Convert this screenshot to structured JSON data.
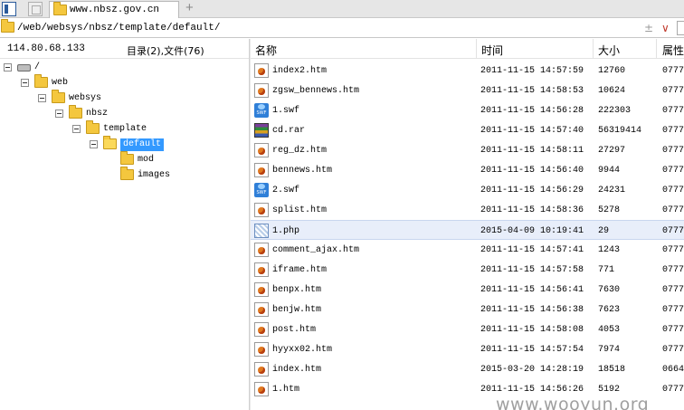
{
  "tab": {
    "title": "www.nbsz.gov.cn",
    "new_tab": "+"
  },
  "address": {
    "path": "/web/websys/nbsz/template/default/",
    "split_glyph": "±",
    "dropdown_glyph": "∨"
  },
  "left": {
    "ip": "114.80.68.133",
    "counts": "目录(2),文件(76)",
    "tree": [
      {
        "label": "/",
        "kind": "drive",
        "depth": 0,
        "expanded": true
      },
      {
        "label": "web",
        "kind": "folder",
        "depth": 1,
        "expanded": true
      },
      {
        "label": "websys",
        "kind": "folder",
        "depth": 2,
        "expanded": true
      },
      {
        "label": "nbsz",
        "kind": "folder",
        "depth": 3,
        "expanded": true
      },
      {
        "label": "template",
        "kind": "folder",
        "depth": 4,
        "expanded": true
      },
      {
        "label": "default",
        "kind": "folder",
        "depth": 5,
        "expanded": true,
        "selected": true
      },
      {
        "label": "mod",
        "kind": "folder",
        "depth": 6
      },
      {
        "label": "images",
        "kind": "folder",
        "depth": 6
      }
    ]
  },
  "columns": {
    "name": "名称",
    "time": "时间",
    "size": "大小",
    "attr": "属性"
  },
  "files": [
    {
      "name": "index2.htm",
      "type": "htm",
      "time": "2011-11-15 14:57:59",
      "size": "12760",
      "attr": "0777"
    },
    {
      "name": "zgsw_bennews.htm",
      "type": "htm",
      "time": "2011-11-15 14:58:53",
      "size": "10624",
      "attr": "0777"
    },
    {
      "name": "1.swf",
      "type": "swf",
      "time": "2011-11-15 14:56:28",
      "size": "222303",
      "attr": "0777"
    },
    {
      "name": "cd.rar",
      "type": "rar",
      "time": "2011-11-15 14:57:40",
      "size": "56319414",
      "attr": "0777"
    },
    {
      "name": "reg_dz.htm",
      "type": "htm",
      "time": "2011-11-15 14:58:11",
      "size": "27297",
      "attr": "0777"
    },
    {
      "name": "bennews.htm",
      "type": "htm",
      "time": "2011-11-15 14:56:40",
      "size": "9944",
      "attr": "0777"
    },
    {
      "name": "2.swf",
      "type": "swf",
      "time": "2011-11-15 14:56:29",
      "size": "24231",
      "attr": "0777"
    },
    {
      "name": "splist.htm",
      "type": "htm",
      "time": "2011-11-15 14:58:36",
      "size": "5278",
      "attr": "0777"
    },
    {
      "name": "1.php",
      "type": "php",
      "time": "2015-04-09 10:19:41",
      "size": "29",
      "attr": "0777",
      "selected": true
    },
    {
      "name": "comment_ajax.htm",
      "type": "htm",
      "time": "2011-11-15 14:57:41",
      "size": "1243",
      "attr": "0777"
    },
    {
      "name": "iframe.htm",
      "type": "htm",
      "time": "2011-11-15 14:57:58",
      "size": "771",
      "attr": "0777"
    },
    {
      "name": "benpx.htm",
      "type": "htm",
      "time": "2011-11-15 14:56:41",
      "size": "7630",
      "attr": "0777"
    },
    {
      "name": "benjw.htm",
      "type": "htm",
      "time": "2011-11-15 14:56:38",
      "size": "7623",
      "attr": "0777"
    },
    {
      "name": "post.htm",
      "type": "htm",
      "time": "2011-11-15 14:58:08",
      "size": "4053",
      "attr": "0777"
    },
    {
      "name": "hyyxx02.htm",
      "type": "htm",
      "time": "2011-11-15 14:57:54",
      "size": "7974",
      "attr": "0777"
    },
    {
      "name": "index.htm",
      "type": "htm",
      "time": "2015-03-20 14:28:19",
      "size": "18518",
      "attr": "0664"
    },
    {
      "name": "1.htm",
      "type": "htm",
      "time": "2011-11-15 14:56:26",
      "size": "5192",
      "attr": "0777"
    }
  ],
  "watermark": "www.wooyun.org"
}
